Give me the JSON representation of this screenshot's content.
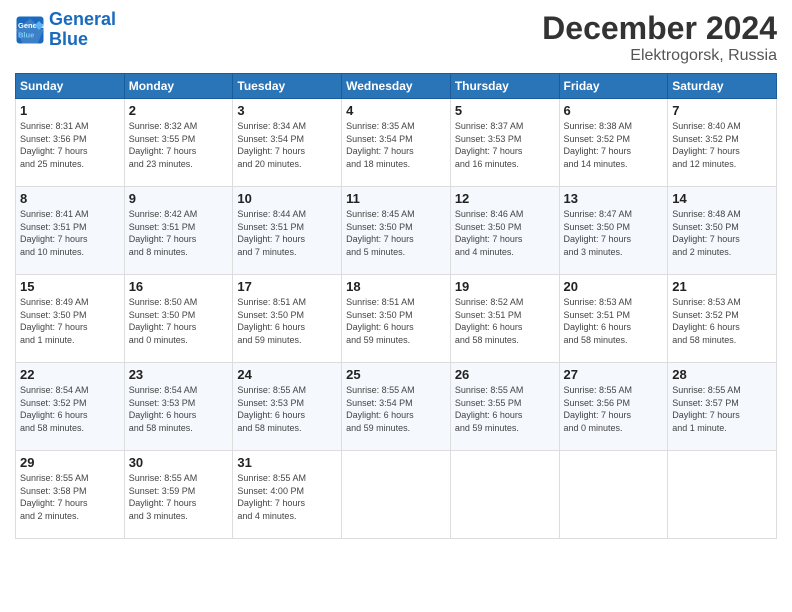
{
  "header": {
    "logo_line1": "General",
    "logo_line2": "Blue",
    "month": "December 2024",
    "location": "Elektrogorsk, Russia"
  },
  "weekdays": [
    "Sunday",
    "Monday",
    "Tuesday",
    "Wednesday",
    "Thursday",
    "Friday",
    "Saturday"
  ],
  "weeks": [
    [
      {
        "day": "1",
        "info": "Sunrise: 8:31 AM\nSunset: 3:56 PM\nDaylight: 7 hours\nand 25 minutes."
      },
      {
        "day": "2",
        "info": "Sunrise: 8:32 AM\nSunset: 3:55 PM\nDaylight: 7 hours\nand 23 minutes."
      },
      {
        "day": "3",
        "info": "Sunrise: 8:34 AM\nSunset: 3:54 PM\nDaylight: 7 hours\nand 20 minutes."
      },
      {
        "day": "4",
        "info": "Sunrise: 8:35 AM\nSunset: 3:54 PM\nDaylight: 7 hours\nand 18 minutes."
      },
      {
        "day": "5",
        "info": "Sunrise: 8:37 AM\nSunset: 3:53 PM\nDaylight: 7 hours\nand 16 minutes."
      },
      {
        "day": "6",
        "info": "Sunrise: 8:38 AM\nSunset: 3:52 PM\nDaylight: 7 hours\nand 14 minutes."
      },
      {
        "day": "7",
        "info": "Sunrise: 8:40 AM\nSunset: 3:52 PM\nDaylight: 7 hours\nand 12 minutes."
      }
    ],
    [
      {
        "day": "8",
        "info": "Sunrise: 8:41 AM\nSunset: 3:51 PM\nDaylight: 7 hours\nand 10 minutes."
      },
      {
        "day": "9",
        "info": "Sunrise: 8:42 AM\nSunset: 3:51 PM\nDaylight: 7 hours\nand 8 minutes."
      },
      {
        "day": "10",
        "info": "Sunrise: 8:44 AM\nSunset: 3:51 PM\nDaylight: 7 hours\nand 7 minutes."
      },
      {
        "day": "11",
        "info": "Sunrise: 8:45 AM\nSunset: 3:50 PM\nDaylight: 7 hours\nand 5 minutes."
      },
      {
        "day": "12",
        "info": "Sunrise: 8:46 AM\nSunset: 3:50 PM\nDaylight: 7 hours\nand 4 minutes."
      },
      {
        "day": "13",
        "info": "Sunrise: 8:47 AM\nSunset: 3:50 PM\nDaylight: 7 hours\nand 3 minutes."
      },
      {
        "day": "14",
        "info": "Sunrise: 8:48 AM\nSunset: 3:50 PM\nDaylight: 7 hours\nand 2 minutes."
      }
    ],
    [
      {
        "day": "15",
        "info": "Sunrise: 8:49 AM\nSunset: 3:50 PM\nDaylight: 7 hours\nand 1 minute."
      },
      {
        "day": "16",
        "info": "Sunrise: 8:50 AM\nSunset: 3:50 PM\nDaylight: 7 hours\nand 0 minutes."
      },
      {
        "day": "17",
        "info": "Sunrise: 8:51 AM\nSunset: 3:50 PM\nDaylight: 6 hours\nand 59 minutes."
      },
      {
        "day": "18",
        "info": "Sunrise: 8:51 AM\nSunset: 3:50 PM\nDaylight: 6 hours\nand 59 minutes."
      },
      {
        "day": "19",
        "info": "Sunrise: 8:52 AM\nSunset: 3:51 PM\nDaylight: 6 hours\nand 58 minutes."
      },
      {
        "day": "20",
        "info": "Sunrise: 8:53 AM\nSunset: 3:51 PM\nDaylight: 6 hours\nand 58 minutes."
      },
      {
        "day": "21",
        "info": "Sunrise: 8:53 AM\nSunset: 3:52 PM\nDaylight: 6 hours\nand 58 minutes."
      }
    ],
    [
      {
        "day": "22",
        "info": "Sunrise: 8:54 AM\nSunset: 3:52 PM\nDaylight: 6 hours\nand 58 minutes."
      },
      {
        "day": "23",
        "info": "Sunrise: 8:54 AM\nSunset: 3:53 PM\nDaylight: 6 hours\nand 58 minutes."
      },
      {
        "day": "24",
        "info": "Sunrise: 8:55 AM\nSunset: 3:53 PM\nDaylight: 6 hours\nand 58 minutes."
      },
      {
        "day": "25",
        "info": "Sunrise: 8:55 AM\nSunset: 3:54 PM\nDaylight: 6 hours\nand 59 minutes."
      },
      {
        "day": "26",
        "info": "Sunrise: 8:55 AM\nSunset: 3:55 PM\nDaylight: 6 hours\nand 59 minutes."
      },
      {
        "day": "27",
        "info": "Sunrise: 8:55 AM\nSunset: 3:56 PM\nDaylight: 7 hours\nand 0 minutes."
      },
      {
        "day": "28",
        "info": "Sunrise: 8:55 AM\nSunset: 3:57 PM\nDaylight: 7 hours\nand 1 minute."
      }
    ],
    [
      {
        "day": "29",
        "info": "Sunrise: 8:55 AM\nSunset: 3:58 PM\nDaylight: 7 hours\nand 2 minutes."
      },
      {
        "day": "30",
        "info": "Sunrise: 8:55 AM\nSunset: 3:59 PM\nDaylight: 7 hours\nand 3 minutes."
      },
      {
        "day": "31",
        "info": "Sunrise: 8:55 AM\nSunset: 4:00 PM\nDaylight: 7 hours\nand 4 minutes."
      },
      null,
      null,
      null,
      null
    ]
  ]
}
